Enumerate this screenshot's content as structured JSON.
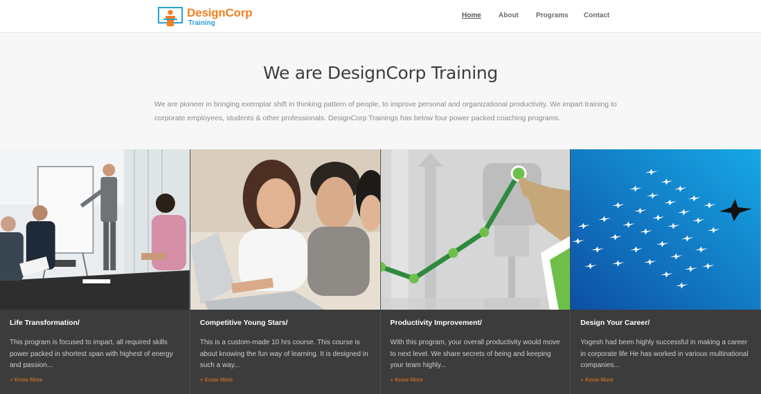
{
  "header": {
    "logo": {
      "title": "DesignCorp",
      "subtitle": "Training"
    },
    "nav": [
      {
        "label": "Home",
        "active": true
      },
      {
        "label": "About",
        "active": false
      },
      {
        "label": "Programs",
        "active": false
      },
      {
        "label": "Contact",
        "active": false
      }
    ]
  },
  "hero": {
    "title": "We are DesignCorp Training",
    "text": "We are pioneer in bringing exemplar shift in thinking pattern of people, to improve personal and organizational productivity. We impart training to corporate employees, students & other professionals. DesignCorp Trainings has below four power packed coaching programs."
  },
  "programs": [
    {
      "title": "Life Transformation/",
      "description": "This program is focused to impart, all required skills power packed in shortest span with highest of energy and passion...",
      "link": "+ Know More",
      "image": "office-presentation-photo"
    },
    {
      "title": "Competitive Young Stars/",
      "description": "This is a custom-made 10 hrs course. This course is about knowing the fun way of learning. It is designed in such a way...",
      "link": "+ Know More",
      "image": "students-laptop-photo"
    },
    {
      "title": "Productivity Improvement/",
      "description": "With this program, your overall productivity would move to next level. We share secrets of being and keeping your team highly...",
      "link": "+ Know More",
      "image": "growth-graph-illustration"
    },
    {
      "title": "Design Your Career/",
      "description": "Yogesh had been highly successful in making a career in corporate life He has worked in various multinational companies...",
      "link": "+ Know More",
      "image": "birds-flock-illustration"
    }
  ],
  "colors": {
    "accent_orange": "#f0811f",
    "accent_blue": "#2a9fd8",
    "card_bg": "#3c3c3c",
    "link_orange": "#e87a1e",
    "hero_bg": "#f7f7f7"
  }
}
